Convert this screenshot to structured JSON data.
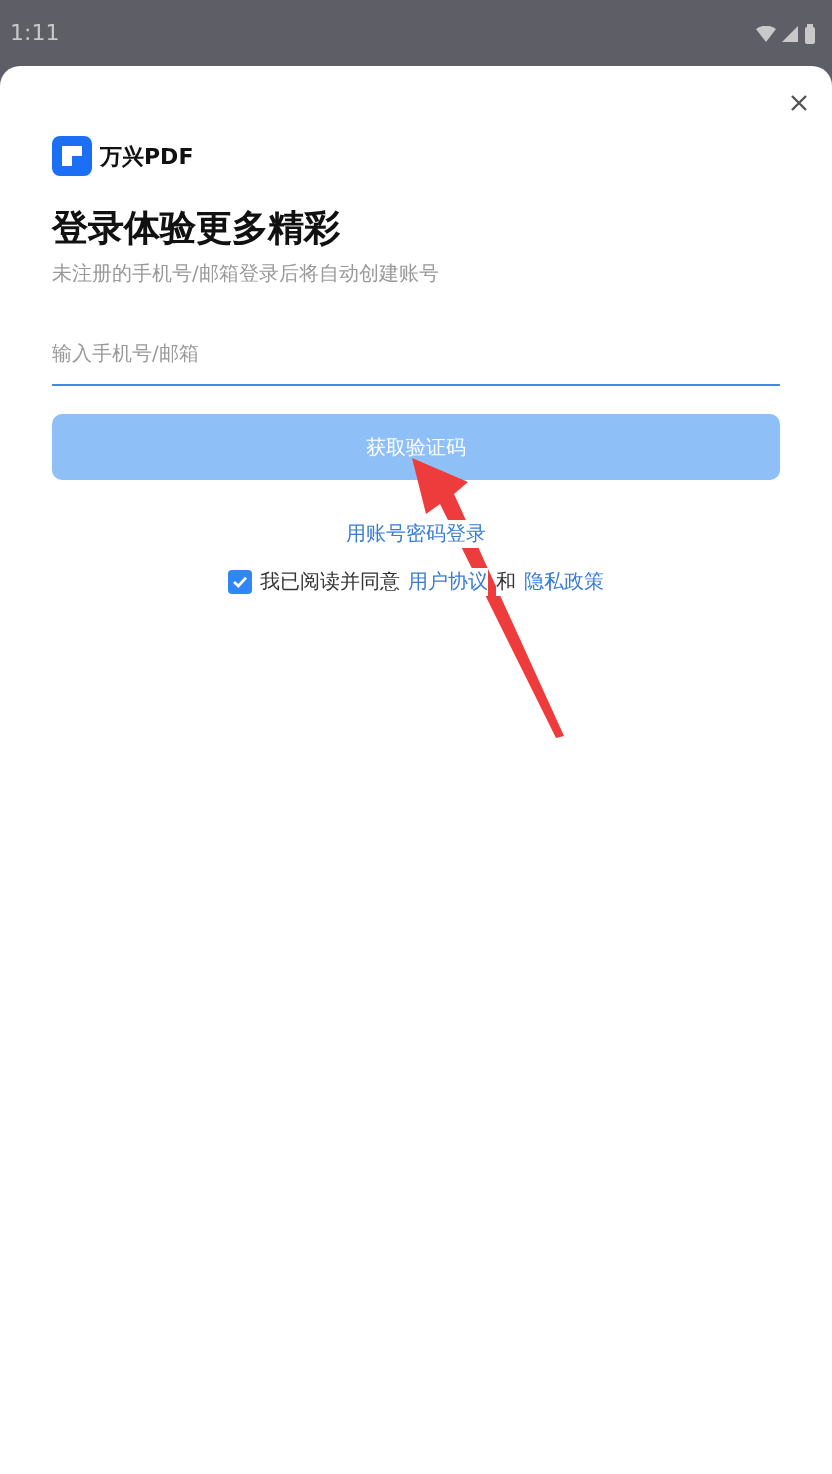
{
  "status_bar": {
    "time": "1:11"
  },
  "brand": {
    "name": "万兴PDF"
  },
  "title": "登录体验更多精彩",
  "subtitle": "未注册的手机号/邮箱登录后将自动创建账号",
  "phone_field": {
    "placeholder": "输入手机号/邮箱"
  },
  "submit_button": {
    "label": "获取验证码",
    "disabled": true
  },
  "password_login_link": "用账号密码登录",
  "agreement": {
    "checked": true,
    "text": "我已阅读并同意",
    "link_1": "用户协议",
    "joiner": "和",
    "link_2": "隐私政策"
  }
}
